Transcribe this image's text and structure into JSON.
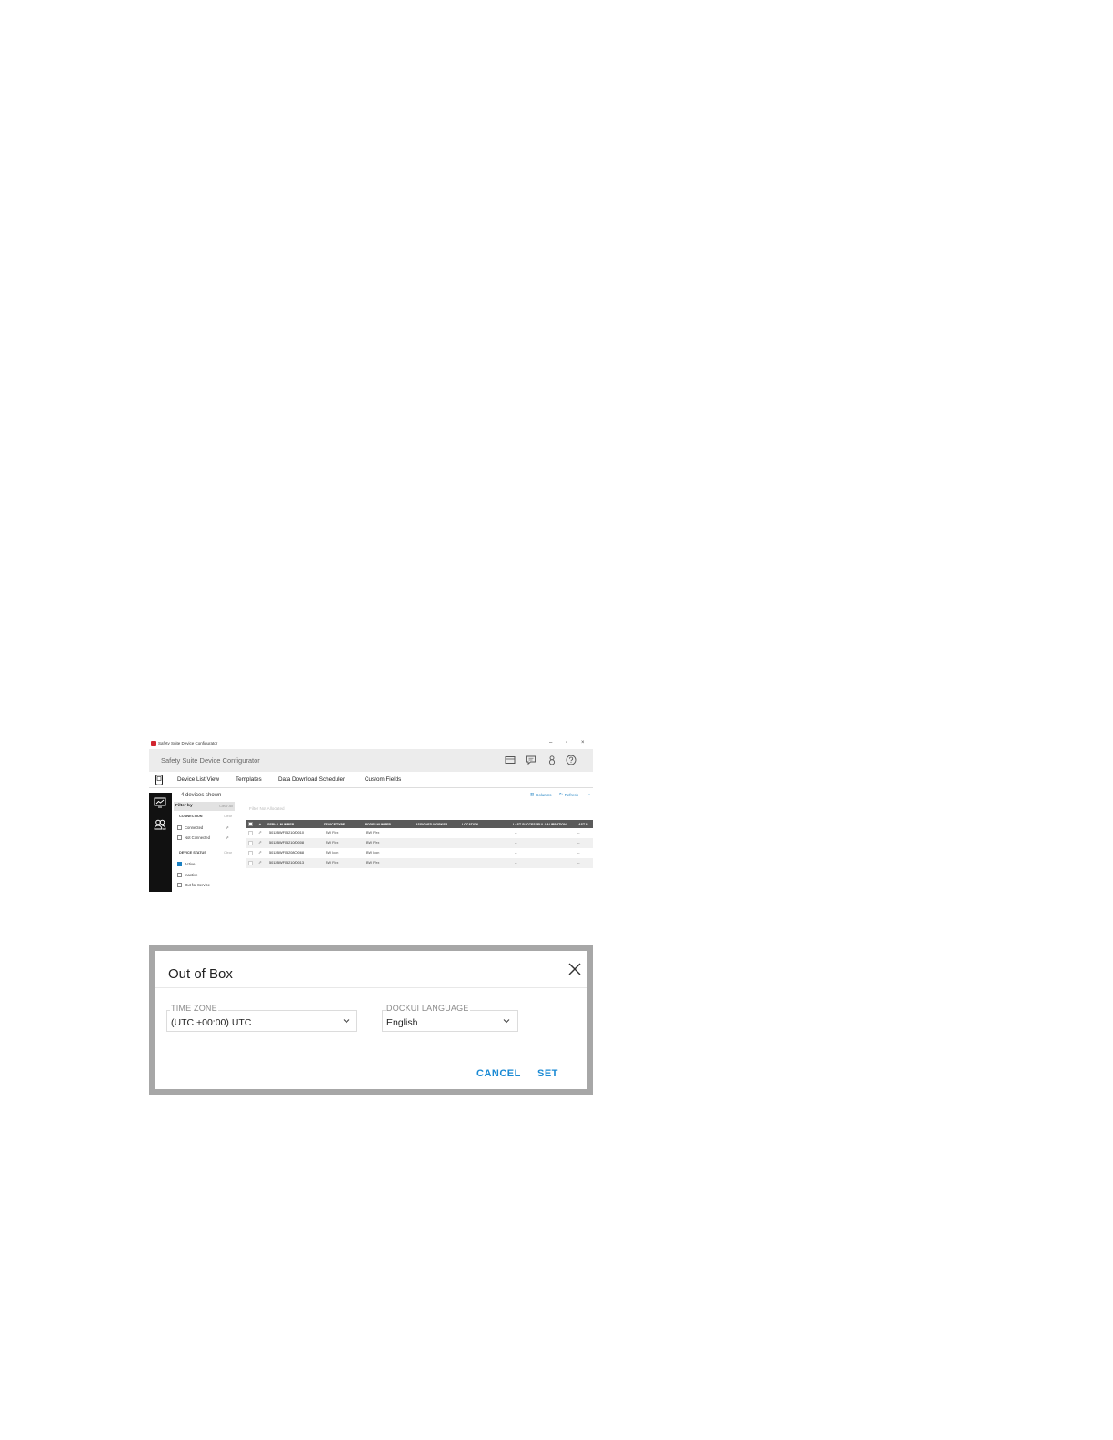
{
  "window": {
    "title": "Safety Suite Device Configurator",
    "controls": {
      "minimize": "–",
      "maximize": "▫",
      "close": "×"
    }
  },
  "app": {
    "name": "Safety Suite Device Configurator",
    "header_icons": [
      "dock-icon",
      "chat-icon",
      "user-icon",
      "help-icon"
    ]
  },
  "tabs": [
    "Device List View",
    "Templates",
    "Data Download Scheduler",
    "Custom Fields"
  ],
  "devices_shown": "4 devices shown",
  "toolbar": {
    "columns": "Columns",
    "refresh": "Refresh",
    "more": "···"
  },
  "filter": {
    "title": "Filter by",
    "clear_all": "Clear All",
    "connection": {
      "title": "CONNECTION",
      "clear": "Clear",
      "options": [
        "Connected",
        "Not Connected"
      ]
    },
    "device_status": {
      "title": "DEVICE STATUS",
      "clear": "Clear",
      "options": [
        "Active",
        "Inactive",
        "Out for Service"
      ],
      "checked": "Active"
    }
  },
  "search": {
    "placeholder": "Filter Not Allocated"
  },
  "table": {
    "columns": [
      "SERIAL NUMBER",
      "DEVICE TYPE",
      "MODEL NUMBER",
      "ASSIGNED WORKER",
      "LOCATION",
      "LAST SUCCESSFUL CALIBRATION",
      "LAST B"
    ],
    "rows": [
      {
        "serial": "5012BWF0521080010",
        "type": "BW Flex",
        "model": "BW Flex",
        "cal": "--",
        "last": "--"
      },
      {
        "serial": "5012BWF0521080008",
        "type": "BW Flex",
        "model": "BW Flex",
        "cal": "--",
        "last": "--"
      },
      {
        "serial": "5012BWF0520800068",
        "type": "BW Icon",
        "model": "BW Icon",
        "cal": "--",
        "last": "--"
      },
      {
        "serial": "5012BWF0521080013",
        "type": "BW Flex",
        "model": "BW Flex",
        "cal": "--",
        "last": "--"
      }
    ]
  },
  "dialog": {
    "title": "Out of Box",
    "time_zone": {
      "label": "TIME ZONE",
      "value": "(UTC +00:00) UTC"
    },
    "language": {
      "label": "DOCKUI LANGUAGE",
      "value": "English"
    },
    "cancel": "CANCEL",
    "set": "SET"
  },
  "colors": {
    "accent": "#1a8ad4",
    "brand_red": "#d22630",
    "header_gray": "#5a5a5a",
    "frame_gray": "#a7a7a7"
  }
}
